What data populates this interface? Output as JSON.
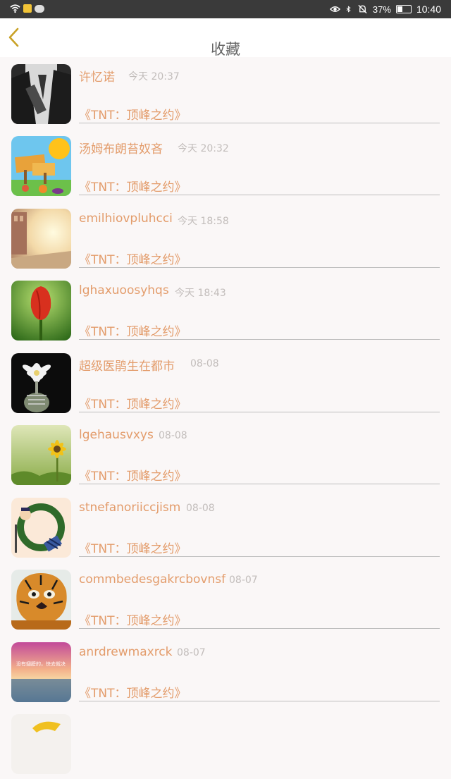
{
  "status_bar": {
    "battery": "37%",
    "time": "10:40",
    "icons": [
      "wifi-icon",
      "app-badge-icon",
      "chat-icon",
      "eye-icon",
      "bluetooth-icon",
      "mute-icon",
      "battery-icon"
    ]
  },
  "header": {
    "title": "收藏",
    "back_icon": "chevron-left-icon"
  },
  "colors": {
    "accent": "#e39c6b",
    "muted": "#c2bdbb",
    "back_arrow": "#c9a227"
  },
  "items": [
    {
      "user": "许忆诺",
      "time": "今天 20:37",
      "book": "《TNT：顶峰之约》",
      "avatar": "man-in-suit"
    },
    {
      "user": "汤姆布朗苔奴吝",
      "time": "今天 20:32",
      "book": "《TNT：顶峰之约》",
      "avatar": "farm-sign"
    },
    {
      "user": "emilhiovpluhcci",
      "time": "今天 18:58",
      "book": "《TNT：顶峰之约》",
      "avatar": "street-sunlight"
    },
    {
      "user": "lghaxuoosyhqs",
      "time": "今天 18:43",
      "book": "《TNT：顶峰之约》",
      "avatar": "red-tulip"
    },
    {
      "user": "超级医鹃生在都市",
      "time": "08-08",
      "book": "《TNT：顶峰之约》",
      "avatar": "white-cactus-flower"
    },
    {
      "user": "lgehausvxys",
      "time": "08-08",
      "book": "《TNT：顶峰之约》",
      "avatar": "sunflower-field"
    },
    {
      "user": "stnefanoriiccjism",
      "time": "08-08",
      "book": "《TNT：顶峰之约》",
      "avatar": "cartoon-ring"
    },
    {
      "user": "commbedesgakrcbovnsf",
      "time": "08-07",
      "book": "《TNT：顶峰之约》",
      "avatar": "tiger"
    },
    {
      "user": "anrdrewmaxrck",
      "time": "08-07",
      "book": "《TNT：顶峰之约》",
      "avatar": "sunset-sea",
      "avatar_text": "没有翅膀的，快去就决"
    }
  ]
}
